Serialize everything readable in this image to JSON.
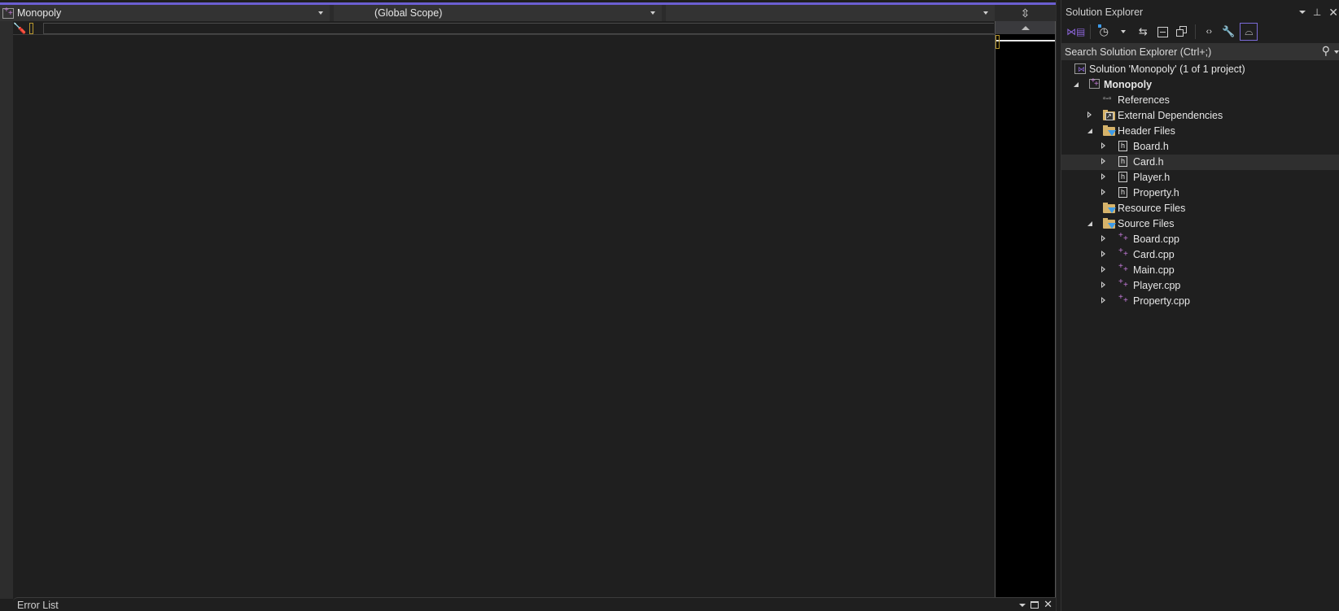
{
  "editor": {
    "nav_project": "Monopoly",
    "nav_scope": "(Global Scope)",
    "nav_member": "",
    "split_icon": "split-window-icon"
  },
  "error_list": {
    "title": "Error List"
  },
  "solution_explorer": {
    "title": "Solution Explorer",
    "search_placeholder": "Search Solution Explorer (Ctrl+;)",
    "toolbar": [
      {
        "name": "switch-views-icon"
      },
      {
        "name": "pending-changes-filter-icon"
      },
      {
        "name": "sync-with-active-document-icon"
      },
      {
        "name": "collapse-all-icon"
      },
      {
        "name": "show-all-files-icon"
      },
      {
        "name": "view-code-icon"
      },
      {
        "name": "properties-icon"
      },
      {
        "name": "preview-selected-items-icon",
        "active": true
      }
    ],
    "tree": [
      {
        "label": "Solution 'Monopoly' (1 of 1 project)",
        "level": 0,
        "type": "solution",
        "expand": "none"
      },
      {
        "label": "Monopoly",
        "level": 1,
        "type": "project",
        "expand": "open",
        "bold": true
      },
      {
        "label": "References",
        "level": 2,
        "type": "references",
        "expand": "none"
      },
      {
        "label": "External Dependencies",
        "level": 2,
        "type": "ext-folder",
        "expand": "closed"
      },
      {
        "label": "Header Files",
        "level": 2,
        "type": "filter-folder",
        "expand": "open"
      },
      {
        "label": "Board.h",
        "level": 3,
        "type": "header",
        "expand": "closed"
      },
      {
        "label": "Card.h",
        "level": 3,
        "type": "header",
        "expand": "closed",
        "selected": true
      },
      {
        "label": "Player.h",
        "level": 3,
        "type": "header",
        "expand": "closed"
      },
      {
        "label": "Property.h",
        "level": 3,
        "type": "header",
        "expand": "closed"
      },
      {
        "label": "Resource Files",
        "level": 2,
        "type": "filter-folder",
        "expand": "none"
      },
      {
        "label": "Source Files",
        "level": 2,
        "type": "filter-folder",
        "expand": "open"
      },
      {
        "label": "Board.cpp",
        "level": 3,
        "type": "cpp",
        "expand": "closed"
      },
      {
        "label": "Card.cpp",
        "level": 3,
        "type": "cpp",
        "expand": "closed"
      },
      {
        "label": "Main.cpp",
        "level": 3,
        "type": "cpp",
        "expand": "closed"
      },
      {
        "label": "Player.cpp",
        "level": 3,
        "type": "cpp",
        "expand": "closed"
      },
      {
        "label": "Property.cpp",
        "level": 3,
        "type": "cpp",
        "expand": "closed"
      }
    ]
  },
  "colors": {
    "accent": "#6b5fd1",
    "background": "#1f1f1f",
    "selection": "#2f2f2f",
    "folder": "#d6b36a",
    "cpp_icon": "#c57bdb"
  }
}
